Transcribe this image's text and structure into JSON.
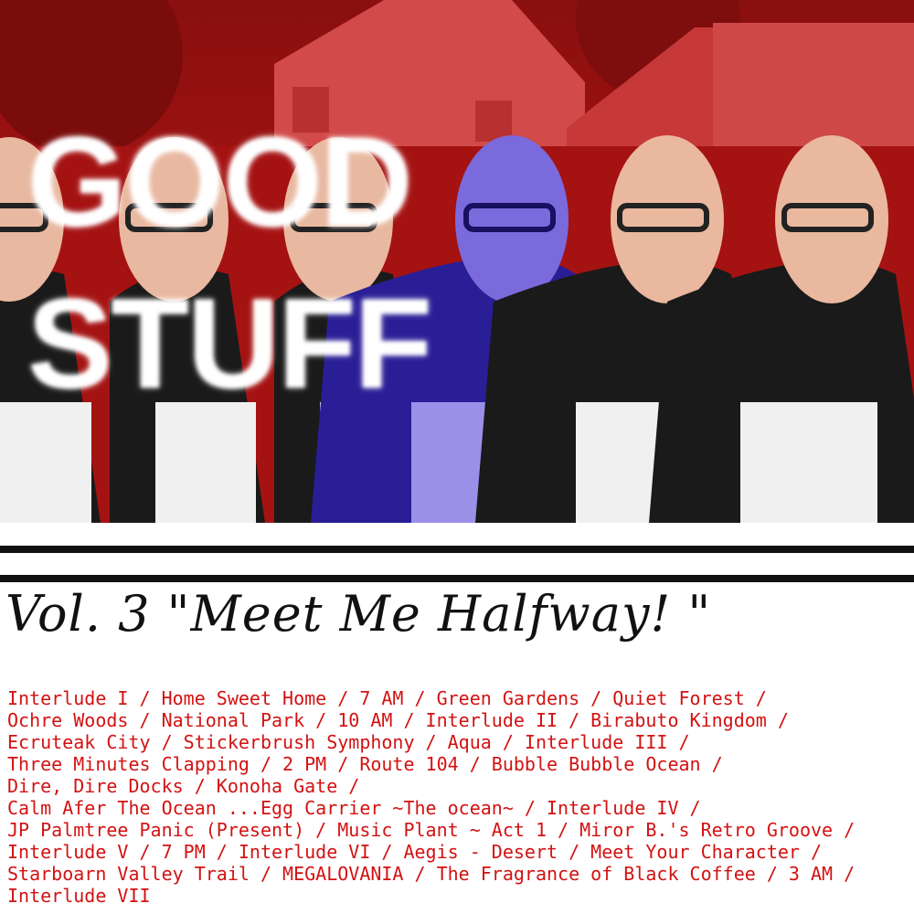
{
  "album": {
    "title_line1": "GOOD",
    "title_line2": "STUFF",
    "volume_title": "Vol. 3 \"Meet Me Halfway! \"",
    "tracklist_lines": [
      "Interlude I / Home Sweet Home / 7 AM / Green Gardens / Quiet Forest /",
      "Ochre Woods / National Park / 10 AM / Interlude II / Birabuto Kingdom /",
      "Ecruteak City / Stickerbrush Symphony / Aqua / Interlude III /",
      "Three Minutes Clapping / 2 PM / Route 104 / Bubble Bubble Ocean /",
      "Dire, Dire Docks / Konoha Gate /",
      "Calm Afer The Ocean ...Egg Carrier ~The ocean~ / Interlude IV /",
      "JP Palmtree Panic (Present) / Music Plant ~ Act 1 / Miror B.'s Retro Groove /",
      "Interlude V / 7 PM / Interlude VI / Aegis - Desert / Meet Your Character /",
      "Starboarn Valley Trail / MEGALOVANIA / The Fragrance of Black Coffee / 3 AM /",
      "Interlude VII"
    ]
  },
  "colors": {
    "background_red": "#b01414",
    "track_text": "#d31212",
    "highlight_figure": "#3020a0"
  }
}
